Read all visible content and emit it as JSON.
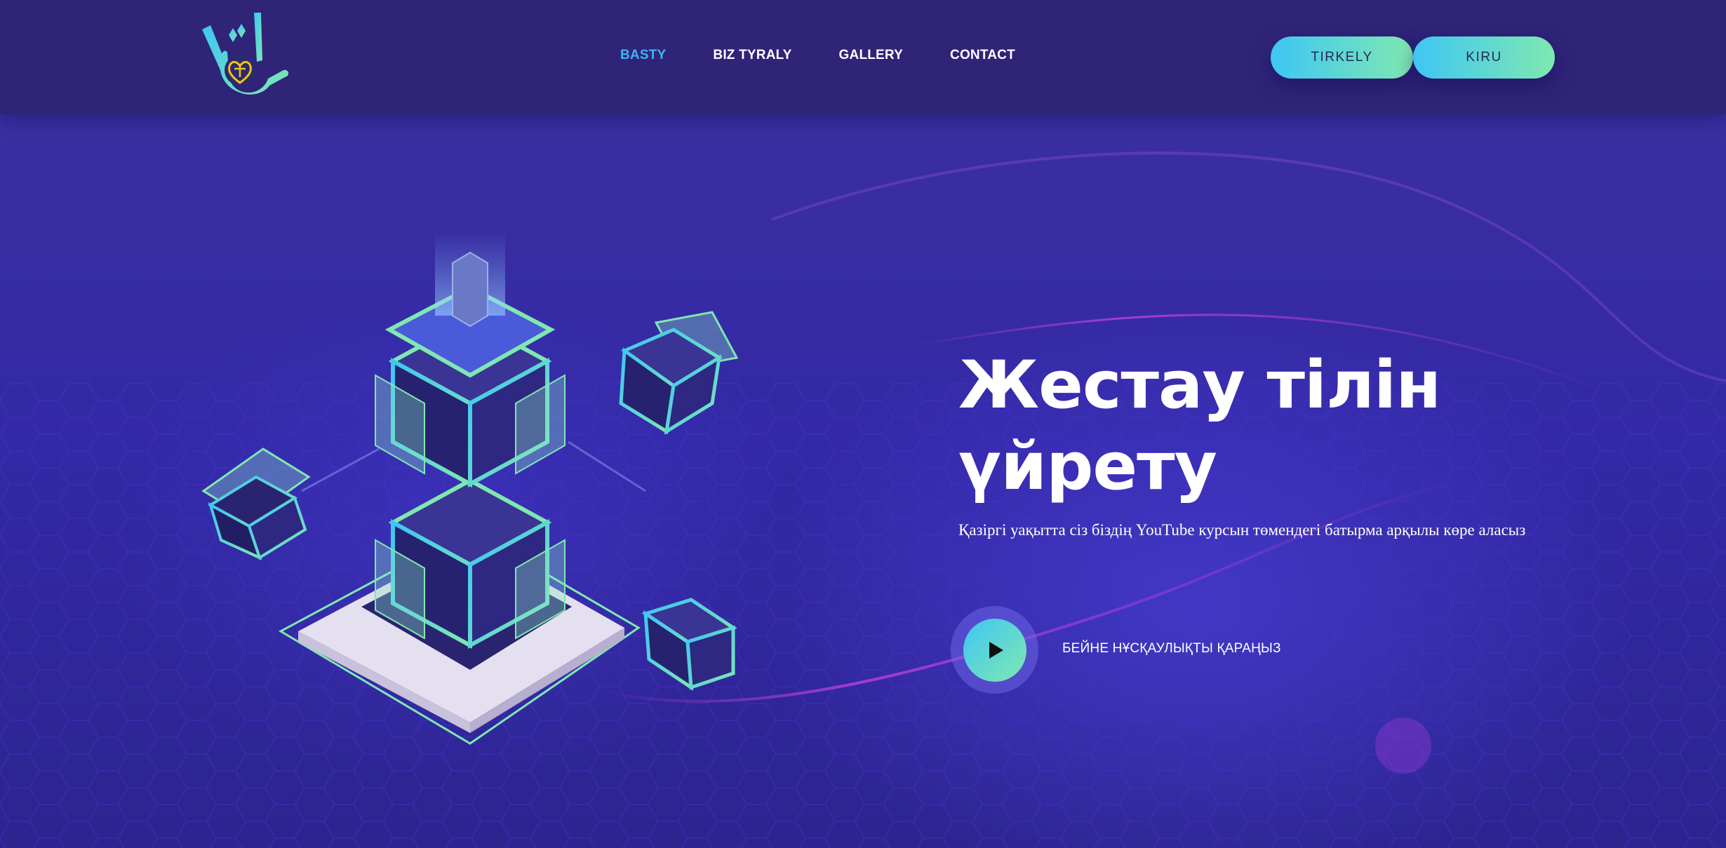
{
  "header": {
    "nav": [
      {
        "label": "BASTY",
        "active": true
      },
      {
        "label": "BIZ TYRALY",
        "active": false
      },
      {
        "label": "GALLERY",
        "active": false
      },
      {
        "label": "CONTACT",
        "active": false
      }
    ],
    "register_label": "TIRKELY",
    "login_label": "KIRU"
  },
  "hero": {
    "title_line1": "Жестау тілін",
    "title_line2": "үйрету",
    "subtitle": "Қазіргі уақытта сіз біздің YouTube курсын төмендегі батырма арқылы көре аласыз",
    "play_label": "БЕЙНЕ НҰСҚАУЛЫҚТЫ ҚАРАҢЫЗ"
  },
  "icons": {
    "logo": "sign-language-hand-logo",
    "play": "play-icon"
  },
  "colors": {
    "nav_active": "#3fb4f2",
    "header_bg": "#2f2478",
    "hero_bg": "#3328a6",
    "button_gradient_start": "#3ec6f4",
    "button_gradient_end": "#7fe8b0"
  }
}
